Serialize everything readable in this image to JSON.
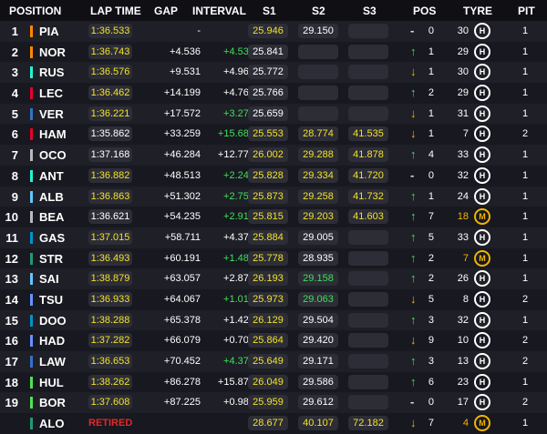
{
  "header": {
    "position": "POSITION",
    "lap_time": "LAP TIME",
    "gap": "GAP",
    "interval": "INTERVAL",
    "s1": "S1",
    "s2": "S2",
    "s3": "S3",
    "pos": "POS",
    "tyre": "TYRE",
    "pit": "PIT"
  },
  "rows": [
    {
      "pos": "1",
      "driver": "PIA",
      "team_color": "#ff8700",
      "lap": "1:36.533",
      "lap_pb": true,
      "gap": "-",
      "interval": "-",
      "interval_green": false,
      "s1": "25.946",
      "s1_c": "y",
      "s2": "29.150",
      "s2_c": "w",
      "s3": "",
      "s3_c": "w",
      "dir": "same",
      "arrow": "-",
      "change": "0",
      "tyre_age": "30",
      "compound": "H",
      "pit": "1"
    },
    {
      "pos": "2",
      "driver": "NOR",
      "team_color": "#ff8700",
      "lap": "1:36.743",
      "lap_pb": true,
      "gap": "+4.536",
      "interval": "+4.536",
      "interval_green": true,
      "s1": "25.841",
      "s1_c": "w",
      "s2": "",
      "s2_c": "w",
      "s3": "",
      "s3_c": "w",
      "dir": "up",
      "arrow": "↑",
      "change": "1",
      "tyre_age": "29",
      "compound": "H",
      "pit": "1"
    },
    {
      "pos": "3",
      "driver": "RUS",
      "team_color": "#27f4d2",
      "lap": "1:36.576",
      "lap_pb": true,
      "gap": "+9.531",
      "interval": "+4.965",
      "interval_green": false,
      "s1": "25.772",
      "s1_c": "w",
      "s2": "",
      "s2_c": "w",
      "s3": "",
      "s3_c": "w",
      "dir": "down",
      "arrow": "↓",
      "change": "1",
      "tyre_age": "30",
      "compound": "H",
      "pit": "1"
    },
    {
      "pos": "4",
      "driver": "LEC",
      "team_color": "#e8002d",
      "lap": "1:36.462",
      "lap_pb": true,
      "gap": "+14.199",
      "interval": "+4.767",
      "interval_green": false,
      "s1": "25.766",
      "s1_c": "w",
      "s2": "",
      "s2_c": "w",
      "s3": "",
      "s3_c": "w",
      "dir": "up",
      "arrow": "↑",
      "change": "2",
      "tyre_age": "29",
      "compound": "H",
      "pit": "1"
    },
    {
      "pos": "5",
      "driver": "VER",
      "team_color": "#3671c6",
      "lap": "1:36.221",
      "lap_pb": true,
      "gap": "+17.572",
      "interval": "+3.273",
      "interval_green": true,
      "s1": "25.659",
      "s1_c": "w",
      "s2": "",
      "s2_c": "w",
      "s3": "",
      "s3_c": "w",
      "dir": "down",
      "arrow": "↓",
      "change": "1",
      "tyre_age": "31",
      "compound": "H",
      "pit": "1"
    },
    {
      "pos": "6",
      "driver": "HAM",
      "team_color": "#e8002d",
      "lap": "1:35.862",
      "lap_pb": false,
      "gap": "+33.259",
      "interval": "+15.682",
      "interval_green": true,
      "s1": "25.553",
      "s1_c": "y",
      "s2": "28.774",
      "s2_c": "y",
      "s3": "41.535",
      "s3_c": "y",
      "dir": "down",
      "arrow": "↓",
      "change": "1",
      "tyre_age": "7",
      "compound": "H",
      "pit": "2"
    },
    {
      "pos": "7",
      "driver": "OCO",
      "team_color": "#b6babd",
      "lap": "1:37.168",
      "lap_pb": false,
      "gap": "+46.284",
      "interval": "+12.772",
      "interval_green": false,
      "s1": "26.002",
      "s1_c": "y",
      "s2": "29.288",
      "s2_c": "y",
      "s3": "41.878",
      "s3_c": "y",
      "dir": "up",
      "arrow": "↑",
      "change": "4",
      "tyre_age": "33",
      "compound": "H",
      "pit": "1"
    },
    {
      "pos": "8",
      "driver": "ANT",
      "team_color": "#27f4d2",
      "lap": "1:36.882",
      "lap_pb": true,
      "gap": "+48.513",
      "interval": "+2.246",
      "interval_green": true,
      "s1": "25.828",
      "s1_c": "y",
      "s2": "29.334",
      "s2_c": "y",
      "s3": "41.720",
      "s3_c": "y",
      "dir": "same",
      "arrow": "-",
      "change": "0",
      "tyre_age": "32",
      "compound": "H",
      "pit": "1"
    },
    {
      "pos": "9",
      "driver": "ALB",
      "team_color": "#64c4ff",
      "lap": "1:36.863",
      "lap_pb": true,
      "gap": "+51.302",
      "interval": "+2.758",
      "interval_green": true,
      "s1": "25.873",
      "s1_c": "y",
      "s2": "29.258",
      "s2_c": "y",
      "s3": "41.732",
      "s3_c": "y",
      "dir": "up",
      "arrow": "↑",
      "change": "1",
      "tyre_age": "24",
      "compound": "H",
      "pit": "1"
    },
    {
      "pos": "10",
      "driver": "BEA",
      "team_color": "#b6babd",
      "lap": "1:36.621",
      "lap_pb": false,
      "gap": "+54.235",
      "interval": "+2.916",
      "interval_green": true,
      "s1": "25.815",
      "s1_c": "y",
      "s2": "29.203",
      "s2_c": "y",
      "s3": "41.603",
      "s3_c": "y",
      "dir": "up",
      "arrow": "↑",
      "change": "7",
      "tyre_age": "18",
      "compound": "M",
      "pit": "1"
    },
    {
      "pos": "11",
      "driver": "GAS",
      "team_color": "#0093cc",
      "lap": "1:37.015",
      "lap_pb": true,
      "gap": "+58.711",
      "interval": "+4.374",
      "interval_green": false,
      "s1": "25.884",
      "s1_c": "y",
      "s2": "29.005",
      "s2_c": "w",
      "s3": "",
      "s3_c": "w",
      "dir": "up",
      "arrow": "↑",
      "change": "5",
      "tyre_age": "33",
      "compound": "H",
      "pit": "1"
    },
    {
      "pos": "12",
      "driver": "STR",
      "team_color": "#229971",
      "lap": "1:36.493",
      "lap_pb": true,
      "gap": "+60.191",
      "interval": "+1.480",
      "interval_green": true,
      "s1": "25.778",
      "s1_c": "y",
      "s2": "28.935",
      "s2_c": "w",
      "s3": "",
      "s3_c": "w",
      "dir": "up",
      "arrow": "↑",
      "change": "2",
      "tyre_age": "7",
      "compound": "M",
      "pit": "1"
    },
    {
      "pos": "13",
      "driver": "SAI",
      "team_color": "#64c4ff",
      "lap": "1:38.879",
      "lap_pb": true,
      "gap": "+63.057",
      "interval": "+2.874",
      "interval_green": false,
      "s1": "26.193",
      "s1_c": "y",
      "s2": "29.158",
      "s2_c": "g",
      "s3": "",
      "s3_c": "w",
      "dir": "up",
      "arrow": "↑",
      "change": "2",
      "tyre_age": "26",
      "compound": "H",
      "pit": "1"
    },
    {
      "pos": "14",
      "driver": "TSU",
      "team_color": "#6692ff",
      "lap": "1:36.933",
      "lap_pb": true,
      "gap": "+64.067",
      "interval": "+1.010",
      "interval_green": true,
      "s1": "25.973",
      "s1_c": "y",
      "s2": "29.063",
      "s2_c": "g",
      "s3": "",
      "s3_c": "w",
      "dir": "down",
      "arrow": "↓",
      "change": "5",
      "tyre_age": "8",
      "compound": "H",
      "pit": "2"
    },
    {
      "pos": "15",
      "driver": "DOO",
      "team_color": "#0093cc",
      "lap": "1:38.288",
      "lap_pb": true,
      "gap": "+65.378",
      "interval": "+1.422",
      "interval_green": false,
      "s1": "26.129",
      "s1_c": "y",
      "s2": "29.504",
      "s2_c": "w",
      "s3": "",
      "s3_c": "w",
      "dir": "up",
      "arrow": "↑",
      "change": "3",
      "tyre_age": "32",
      "compound": "H",
      "pit": "1"
    },
    {
      "pos": "16",
      "driver": "HAD",
      "team_color": "#6692ff",
      "lap": "1:37.282",
      "lap_pb": true,
      "gap": "+66.079",
      "interval": "+0.701",
      "interval_green": false,
      "s1": "25.864",
      "s1_c": "y",
      "s2": "29.420",
      "s2_c": "w",
      "s3": "",
      "s3_c": "w",
      "dir": "down",
      "arrow": "↓",
      "change": "9",
      "tyre_age": "10",
      "compound": "H",
      "pit": "2"
    },
    {
      "pos": "17",
      "driver": "LAW",
      "team_color": "#3671c6",
      "lap": "1:36.653",
      "lap_pb": true,
      "gap": "+70.452",
      "interval": "+4.373",
      "interval_green": true,
      "s1": "25.649",
      "s1_c": "y",
      "s2": "29.171",
      "s2_c": "w",
      "s3": "",
      "s3_c": "w",
      "dir": "up",
      "arrow": "↑",
      "change": "3",
      "tyre_age": "13",
      "compound": "H",
      "pit": "2"
    },
    {
      "pos": "18",
      "driver": "HUL",
      "team_color": "#52e252",
      "lap": "1:38.262",
      "lap_pb": true,
      "gap": "+86.278",
      "interval": "+15.873",
      "interval_green": false,
      "s1": "26.049",
      "s1_c": "y",
      "s2": "29.586",
      "s2_c": "w",
      "s3": "",
      "s3_c": "w",
      "dir": "up",
      "arrow": "↑",
      "change": "6",
      "tyre_age": "23",
      "compound": "H",
      "pit": "1"
    },
    {
      "pos": "19",
      "driver": "BOR",
      "team_color": "#52e252",
      "lap": "1:37.608",
      "lap_pb": true,
      "gap": "+87.225",
      "interval": "+0.980",
      "interval_green": false,
      "s1": "25.959",
      "s1_c": "y",
      "s2": "29.612",
      "s2_c": "w",
      "s3": "",
      "s3_c": "w",
      "dir": "same",
      "arrow": "-",
      "change": "0",
      "tyre_age": "17",
      "compound": "H",
      "pit": "2"
    },
    {
      "pos": "",
      "driver": "ALO",
      "team_color": "#229971",
      "lap": "RETIRED",
      "lap_pb": false,
      "retired": true,
      "gap": "",
      "interval": "",
      "interval_green": false,
      "s1": "28.677",
      "s1_c": "y",
      "s2": "40.107",
      "s2_c": "y",
      "s3": "72.182",
      "s3_c": "y",
      "dir": "down",
      "arrow": "↓",
      "change": "7",
      "tyre_age": "4",
      "compound": "M",
      "pit": "1"
    }
  ]
}
